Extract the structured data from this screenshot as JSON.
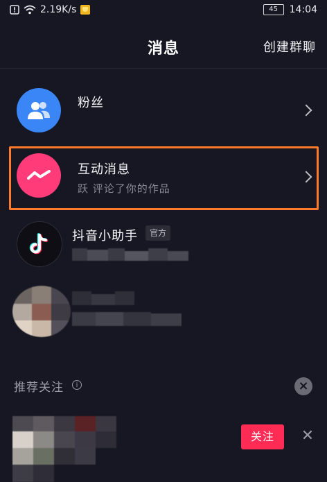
{
  "status_bar": {
    "net_speed": "2.19K/s",
    "battery": "45",
    "time": "14:04"
  },
  "header": {
    "title": "消息",
    "create_group": "创建群聊"
  },
  "rows": {
    "fans": {
      "title": "粉丝"
    },
    "interactions": {
      "title": "互动消息",
      "subtitle": "跃 评论了你的作品"
    },
    "assistant": {
      "title": "抖音小助手",
      "badge": "官方"
    }
  },
  "recommend": {
    "section_title": "推荐关注",
    "follow_label": "关注"
  },
  "icons": {
    "fans": "people-icon",
    "interactions": "interaction-icon",
    "assistant": "tiktok-logo-icon"
  },
  "colors": {
    "background": "#161722",
    "fans_avatar": "#3a86f7",
    "interaction_avatar": "#ff3b79",
    "highlight_border": "#ff7a2d",
    "follow_button": "#fe2c55"
  }
}
